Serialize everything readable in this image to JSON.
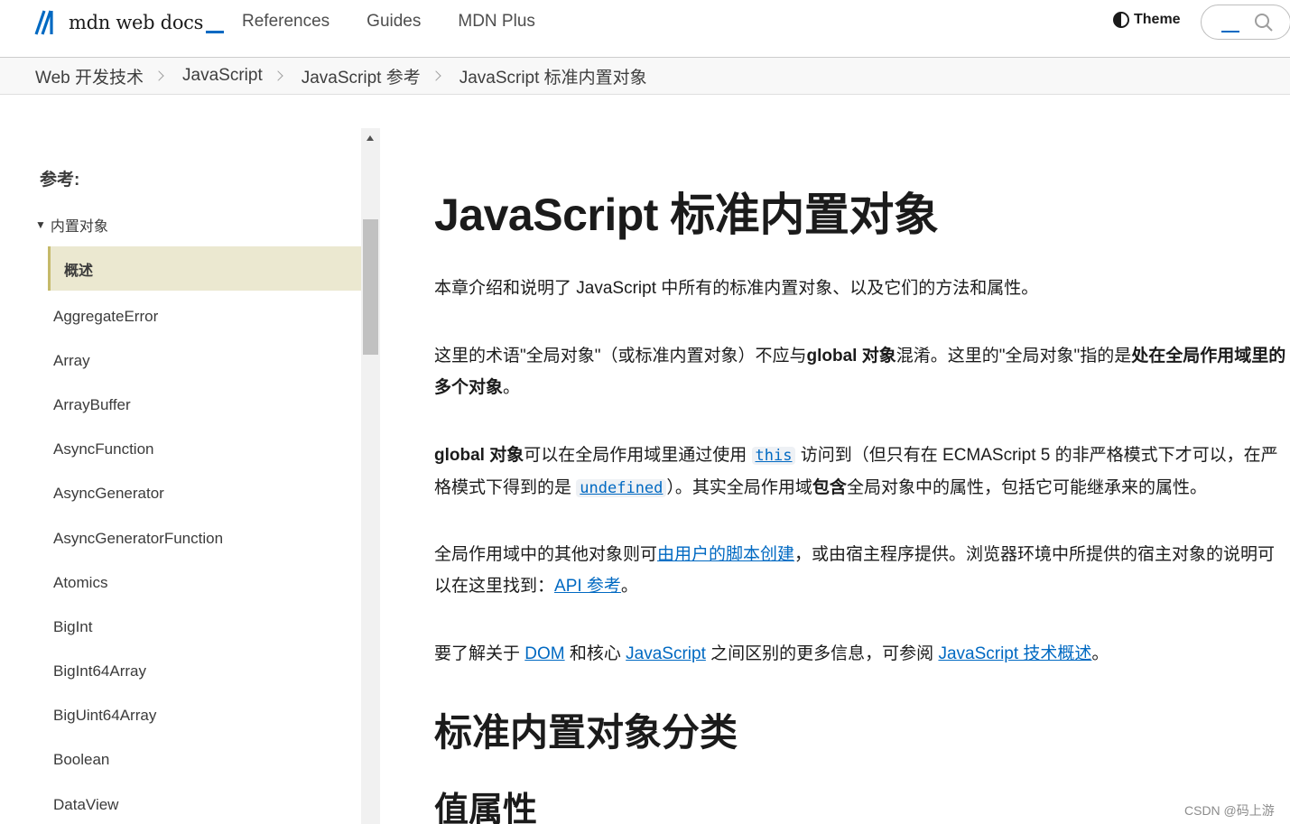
{
  "header": {
    "logo_text": "mdn web docs",
    "nav": [
      "References",
      "Guides",
      "MDN Plus"
    ],
    "theme_label": "Theme"
  },
  "breadcrumb": [
    "Web 开发技术",
    "JavaScript",
    "JavaScript 参考",
    "JavaScript 标准内置对象"
  ],
  "sidebar": {
    "heading": "参考:",
    "group_label": "内置对象",
    "group_toggle": "▼",
    "active_item": "概述",
    "items": [
      "AggregateError",
      "Array",
      "ArrayBuffer",
      "AsyncFunction",
      "AsyncGenerator",
      "AsyncGeneratorFunction",
      "Atomics",
      "BigInt",
      "BigInt64Array",
      "BigUint64Array",
      "Boolean",
      "DataView"
    ]
  },
  "main": {
    "title": "JavaScript 标准内置对象",
    "p1": "本章介绍和说明了 JavaScript 中所有的标准内置对象、以及它们的方法和属性。",
    "p2": {
      "t1": "这里的术语\"全局对象\"（或标准内置对象）不应与",
      "b1": "global 对象",
      "t2": "混淆。这里的\"全局对象\"指的是",
      "b2": "处在全局作用域里的多个对象",
      "t3": "。"
    },
    "p3": {
      "b1": "global 对象",
      "t1": "可以在全局作用域里通过使用 ",
      "code1": "this",
      "t2": " 访问到（但只有在 ECMAScript 5 的非严格模式下才可以，在严格模式下得到的是 ",
      "code2": "undefined",
      "t3": "）。其实全局作用域",
      "b2": "包含",
      "t4": "全局对象中的属性，包括它可能继承来的属性。"
    },
    "p4": {
      "t1": "全局作用域中的其他对象则可",
      "link1": "由用户的脚本创建",
      "t2": "，或由宿主程序提供。浏览器环境中所提供的宿主对象的说明可以在这里找到：",
      "link2": "API 参考",
      "t3": "。"
    },
    "p5": {
      "t1": "要了解关于 ",
      "link1": "DOM",
      "t2": " 和核心 ",
      "link2": "JavaScript",
      "t3": " 之间区别的更多信息，可参阅 ",
      "link3": "JavaScript 技术概述",
      "t4": "。"
    },
    "h2": "标准内置对象分类",
    "h3": "值属性"
  },
  "watermark": "CSDN @码上游",
  "colors": {
    "link": "#0069c2",
    "active_bg": "#ebe8d0",
    "active_border": "#c5ba6a",
    "breadcrumb_bg": "#f8f8f8"
  },
  "icons": [
    "mdn-logo-icon",
    "theme-icon",
    "search-icon",
    "chevron-right-icon",
    "scroll-up-arrow-icon"
  ]
}
